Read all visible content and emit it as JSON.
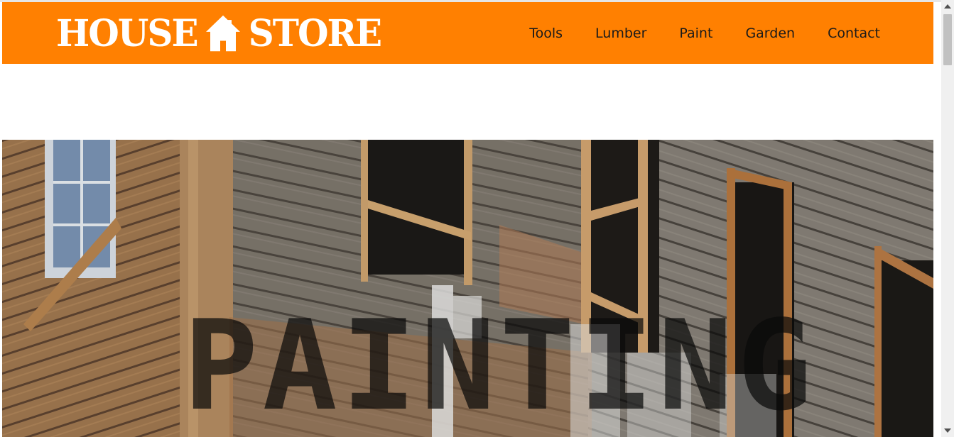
{
  "brand": {
    "name_left": "HOUSE",
    "name_right": "STORE",
    "logo_icon": "house-icon",
    "header_color": "#ff8001"
  },
  "nav": {
    "items": [
      {
        "label": "Tools"
      },
      {
        "label": "Lumber"
      },
      {
        "label": "Paint"
      },
      {
        "label": "Garden"
      },
      {
        "label": "Contact"
      }
    ]
  },
  "hero": {
    "title": "PAINTING",
    "image": "weathered-wooden-house-photo"
  }
}
